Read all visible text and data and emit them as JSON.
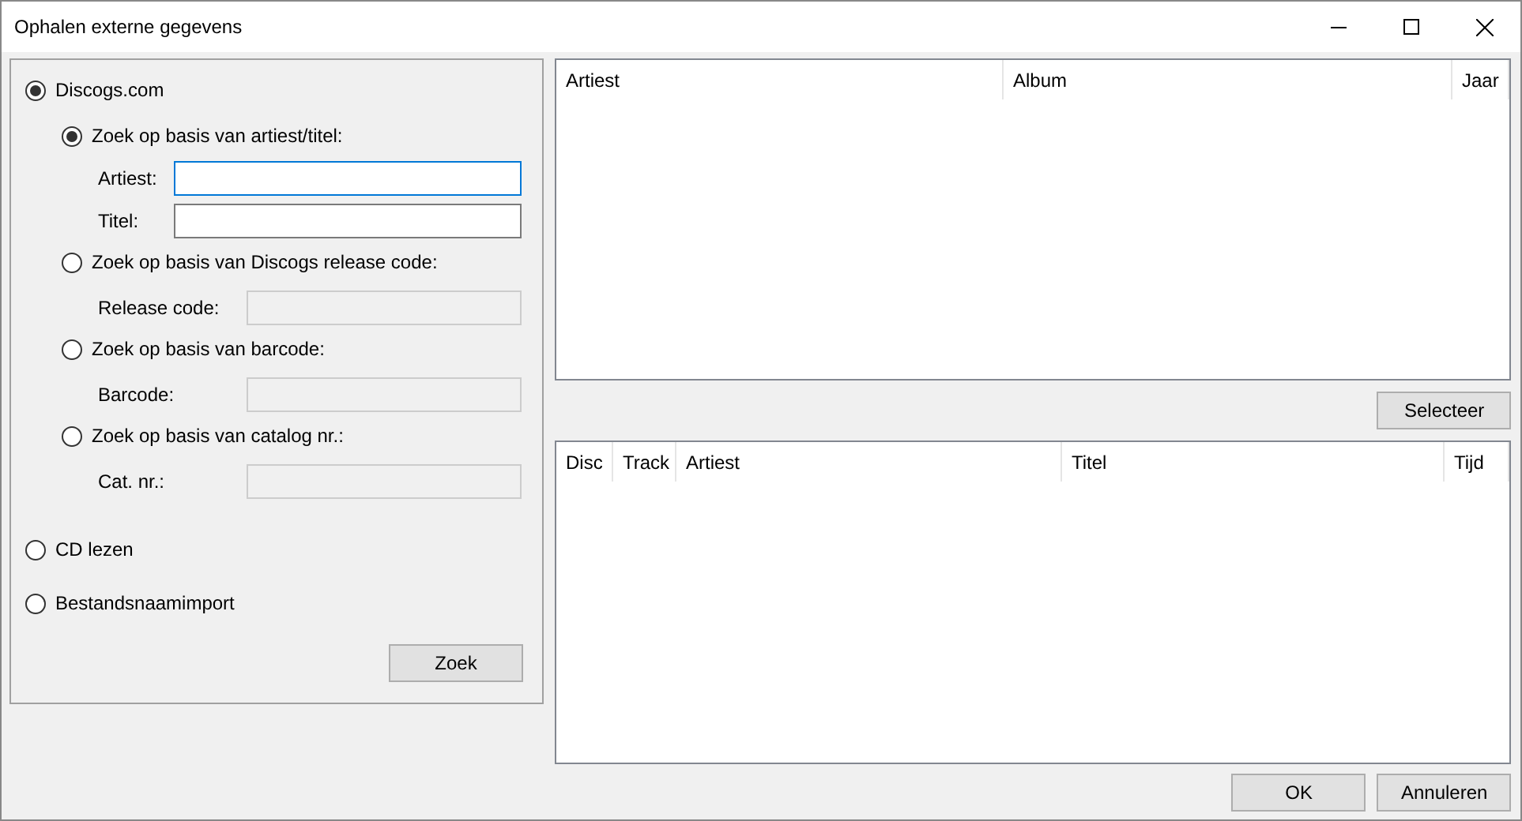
{
  "window": {
    "title": "Ophalen externe gegevens"
  },
  "search_panel": {
    "sources": [
      {
        "label": "Discogs.com",
        "selected": true,
        "methods": [
          {
            "label": "Zoek op basis van artiest/titel:",
            "selected": true,
            "fields": [
              {
                "label": "Artiest:",
                "focused": true,
                "disabled": false
              },
              {
                "label": "Titel:",
                "focused": false,
                "disabled": false
              }
            ]
          },
          {
            "label": "Zoek op basis van Discogs release code:",
            "selected": false,
            "fields": [
              {
                "label": "Release code:",
                "disabled": true
              }
            ]
          },
          {
            "label": "Zoek op basis van barcode:",
            "selected": false,
            "fields": [
              {
                "label": "Barcode:",
                "disabled": true
              }
            ]
          },
          {
            "label": "Zoek op basis van catalog nr.:",
            "selected": false,
            "fields": [
              {
                "label": "Cat. nr.:",
                "disabled": true
              }
            ]
          }
        ]
      },
      {
        "label": "CD lezen",
        "selected": false
      },
      {
        "label": "Bestandsnaamimport",
        "selected": false
      }
    ],
    "search_button": "Zoek"
  },
  "albums_table": {
    "columns": [
      "Artiest",
      "Album",
      "Jaar"
    ]
  },
  "select_button": "Selecteer",
  "tracks_table": {
    "columns": [
      "Disc",
      "Track",
      "Artiest",
      "Titel",
      "Tijd"
    ]
  },
  "buttons": [
    "OK",
    "Annuleren"
  ]
}
